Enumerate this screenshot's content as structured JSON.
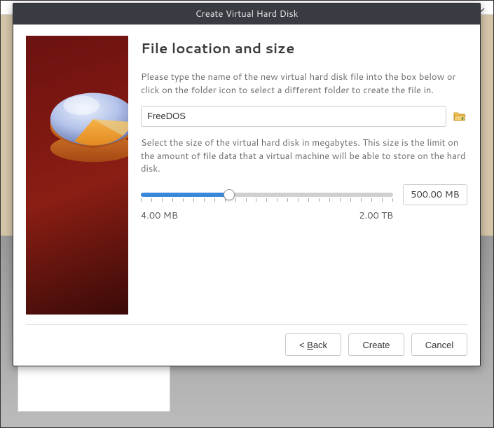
{
  "dialog": {
    "title": "Create Virtual Hard Disk",
    "page_title": "File location and size",
    "desc1": "Please type the name of the new virtual hard disk file into the box below or click on the folder icon to select a different folder to create the file in.",
    "file_value": "FreeDOS",
    "desc2": "Select the size of the virtual hard disk in megabytes. This size is the limit on the amount of file data that a virtual machine will be able to store on the hard disk.",
    "size_value": "500.00 MB",
    "min_label": "4.00 MB",
    "max_label": "2.00 TB",
    "back_prefix": "< ",
    "back_mn": "B",
    "back_suffix": "ack",
    "create_label": "Create",
    "cancel_label": "Cancel"
  },
  "icons": {
    "folder": "folder-browse-icon",
    "chevron": "chevron-down-icon"
  }
}
